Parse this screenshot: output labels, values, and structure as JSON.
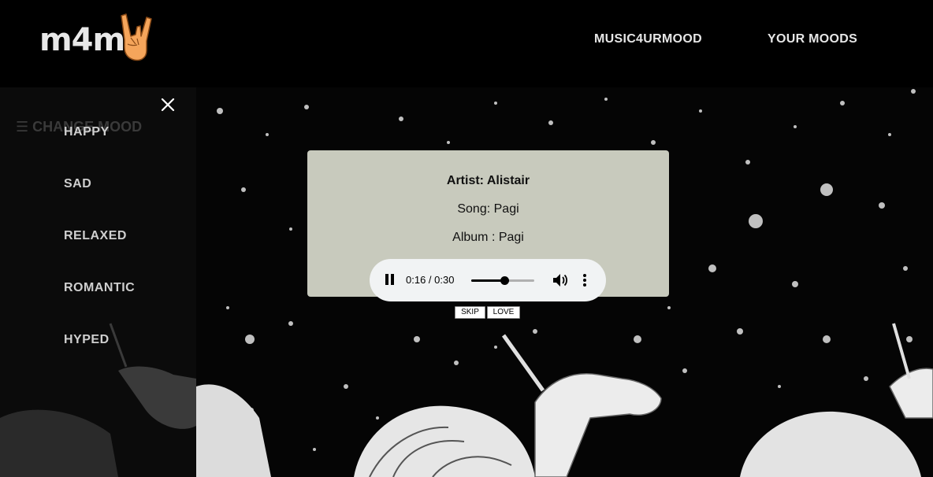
{
  "header": {
    "logo_text": "m4m",
    "nav": [
      "MUSIC4URMOOD",
      "YOUR MOODS"
    ]
  },
  "sidebar": {
    "hidden_label": "☰ CHANGE MOOD",
    "items": [
      "HAPPY",
      "SAD",
      "RELAXED",
      "ROMANTIC",
      "HYPED"
    ]
  },
  "player": {
    "artist": "Artist: Alistair",
    "song": "Song: Pagi",
    "album": "Album : Pagi",
    "time": "0:16 / 0:30",
    "progress": 0.53,
    "skip_label": "SKIP",
    "love_label": "LOVE"
  },
  "colors": {
    "card_bg": "#c8cabd",
    "hand_icon": "#f5a55b",
    "background": "#000000"
  },
  "icons": [
    "rock-hand-icon",
    "close-icon",
    "pause-icon",
    "volume-icon",
    "more-vert-icon"
  ]
}
